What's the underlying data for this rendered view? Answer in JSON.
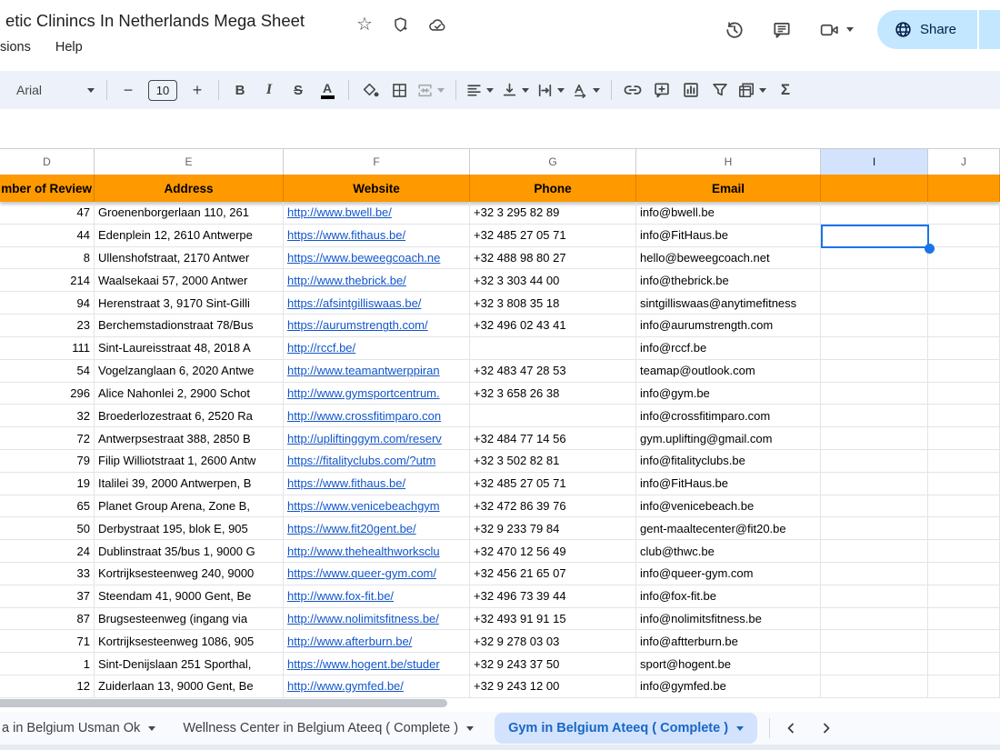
{
  "header": {
    "title": "etic Clinincs In Netherlands Mega Sheet",
    "menu_items": [
      "sions",
      "Help"
    ],
    "share_label": "Share"
  },
  "toolbar": {
    "font_name": "Arial",
    "font_size": "10"
  },
  "grid": {
    "column_letters": [
      "D",
      "E",
      "F",
      "G",
      "H",
      "I",
      "J"
    ],
    "selected_column": "I",
    "header_labels": [
      "mber of Review",
      "Address",
      "Website",
      "Phone",
      "Email",
      "",
      ""
    ],
    "rows": [
      {
        "reviews": "47",
        "address": "Groenenborgerlaan 110, 261",
        "website": "http://www.bwell.be/",
        "phone": "+32 3 295 82 89",
        "email": "info@bwell.be"
      },
      {
        "reviews": "44",
        "address": "Edenplein 12, 2610 Antwerpe",
        "website": "https://www.fithaus.be/",
        "phone": "+32 485 27 05 71",
        "email": "info@FitHaus.be"
      },
      {
        "reviews": "8",
        "address": "Ullenshofstraat, 2170 Antwer",
        "website": "https://www.beweegcoach.ne",
        "phone": "+32 488 98 80 27",
        "email": "hello@beweegcoach.net"
      },
      {
        "reviews": "214",
        "address": "Waalsekaai 57, 2000 Antwer",
        "website": "http://www.thebrick.be/",
        "phone": "+32 3 303 44 00",
        "email": "info@thebrick.be"
      },
      {
        "reviews": "94",
        "address": "Herenstraat 3, 9170 Sint-Gilli",
        "website": "https://afsintgilliswaas.be/",
        "phone": "+32 3 808 35 18",
        "email": "sintgilliswaas@anytimefitness"
      },
      {
        "reviews": "23",
        "address": "Berchemstadionstraat 78/Bus",
        "website": "https://aurumstrength.com/",
        "phone": "+32 496 02 43 41",
        "email": "info@aurumstrength.com"
      },
      {
        "reviews": "111",
        "address": "Sint-Laureisstraat 48, 2018 A",
        "website": "http://rccf.be/",
        "phone": "",
        "email": "info@rccf.be"
      },
      {
        "reviews": "54",
        "address": "Vogelzanglaan 6, 2020 Antwe",
        "website": "http://www.teamantwerppiran",
        "phone": "+32 483 47 28 53",
        "email": "teamap@outlook.com"
      },
      {
        "reviews": "296",
        "address": "Alice Nahonlei 2, 2900 Schot",
        "website": "http://www.gymsportcentrum.",
        "phone": "+32 3 658 26 38",
        "email": "info@gym.be"
      },
      {
        "reviews": "32",
        "address": "Broederlozestraat 6, 2520 Ra",
        "website": "http://www.crossfitimparo.con",
        "phone": "",
        "email": "info@crossfitimparo.com"
      },
      {
        "reviews": "72",
        "address": "Antwerpsestraat 388, 2850 B",
        "website": "http://upliftinggym.com/reserv",
        "phone": "+32 484 77 14 56",
        "email": "gym.uplifting@gmail.com"
      },
      {
        "reviews": "79",
        "address": "Filip Williotstraat 1, 2600 Antw",
        "website": "https://fitalityclubs.com/?utm",
        "phone": "+32 3 502 82 81",
        "email": "info@fitalityclubs.be"
      },
      {
        "reviews": "19",
        "address": "Italilei 39, 2000 Antwerpen, B",
        "website": "https://www.fithaus.be/",
        "phone": "+32 485 27 05 71",
        "email": "info@FitHaus.be"
      },
      {
        "reviews": "65",
        "address": "Planet Group Arena, Zone B,",
        "website": "https://www.venicebeachgym",
        "phone": "+32 472 86 39 76",
        "email": "info@venicebeach.be"
      },
      {
        "reviews": "50",
        "address": "Derbystraat 195, blok E, 905",
        "website": "https://www.fit20gent.be/",
        "phone": "+32 9 233 79 84",
        "email": "gent-maaltecenter@fit20.be"
      },
      {
        "reviews": "24",
        "address": "Dublinstraat 35/bus 1, 9000 G",
        "website": "http://www.thehealthworksclu",
        "phone": "+32 470 12 56 49",
        "email": "club@thwc.be"
      },
      {
        "reviews": "33",
        "address": "Kortrijksesteenweg 240, 9000",
        "website": "https://www.queer-gym.com/",
        "phone": "+32 456 21 65 07",
        "email": "info@queer-gym.com"
      },
      {
        "reviews": "37",
        "address": "Steendam 41, 9000 Gent, Be",
        "website": "http://www.fox-fit.be/",
        "phone": "+32 496 73 39 44",
        "email": "info@fox-fit.be"
      },
      {
        "reviews": "87",
        "address": "Brugsesteenweg (ingang via",
        "website": "http://www.nolimitsfitness.be/",
        "phone": "+32 493 91 91 15",
        "email": "info@nolimitsfitness.be"
      },
      {
        "reviews": "71",
        "address": "Kortrijksesteenweg 1086, 905",
        "website": "http://www.afterburn.be/",
        "phone": "+32 9 278 03 03",
        "email": "info@aftterburn.be"
      },
      {
        "reviews": "1",
        "address": "Sint-Denijslaan 251 Sporthal,",
        "website": "https://www.hogent.be/studer",
        "phone": "+32 9 243 37 50",
        "email": "sport@hogent.be"
      },
      {
        "reviews": "12",
        "address": "Zuiderlaan 13, 9000 Gent, Be",
        "website": "http://www.gymfed.be/",
        "phone": "+32 9 243 12 00",
        "email": "info@gymfed.be"
      }
    ],
    "selected_cell": {
      "column": "I",
      "row_index": 2
    }
  },
  "tabs": [
    {
      "label": "a in Belgium Usman Ok",
      "active": false
    },
    {
      "label": "Wellness Center in Belgium Ateeq ( Complete )",
      "active": false
    },
    {
      "label": "Gym in Belgium Ateeq ( Complete )",
      "active": true
    }
  ],
  "colors": {
    "header_orange": "#ff9900",
    "link_blue": "#1155cc",
    "selection_blue": "#1a73e8",
    "selected_header_bg": "#d3e3fd",
    "active_tab_bg": "#d3e3fd",
    "share_bg": "#c2e7ff"
  }
}
